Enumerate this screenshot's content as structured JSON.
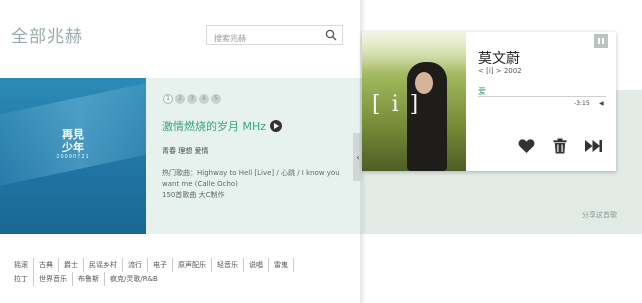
{
  "header": {
    "brand": "全部兆赫",
    "search_placeholder": "搜索兆赫"
  },
  "featured": {
    "cover_title": "再見\n少年",
    "cover_subtitle": "20090721",
    "pages": [
      "1",
      "2",
      "3",
      "4",
      "5"
    ],
    "active_page": 1,
    "title": "激情燃烧的岁月 MHz",
    "tags": "青春  理想  爱情",
    "hot_songs": "热门歌曲：Highway to Hell [Live] / 心跳 / I know you want me (Calle Ocho)",
    "count": "150首歌曲 大C制作"
  },
  "genres": [
    "摇滚",
    "古典",
    "爵士",
    "民谣乡村",
    "流行",
    "电子",
    "原声配乐",
    "轻音乐",
    "说唱",
    "雷鬼",
    "拉丁",
    "世界音乐",
    "布鲁斯",
    "疯克/灵歌/R&B"
  ],
  "player": {
    "artist": "莫文蔚",
    "meta": "< [i] >  2002",
    "song": "爱",
    "time": "-3:15",
    "art_logo": "[ i ]"
  },
  "share_label": "分享这首歌",
  "colors": {
    "accent": "#2f9e73",
    "band": "#e7f2ee",
    "cover_blue": "#2d8ab6"
  }
}
